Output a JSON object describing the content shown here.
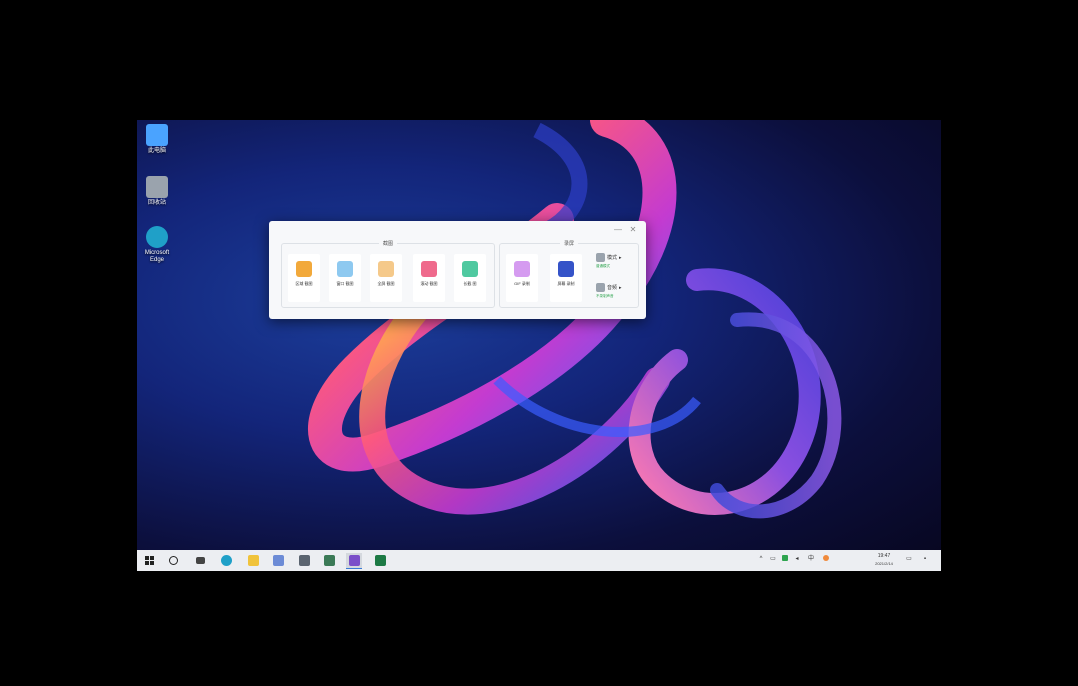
{
  "desktop": {
    "icons": [
      {
        "label": "此电脑",
        "icon": "this-pc-icon",
        "color": "#4aa3ff"
      },
      {
        "label": "回收站",
        "icon": "recycle-bin-icon",
        "color": "#9aa3ad"
      },
      {
        "label": "Microsoft Edge",
        "icon": "edge-icon",
        "color": "#1fa0c8"
      }
    ]
  },
  "dialog": {
    "groups": [
      {
        "title": "截图",
        "tools": [
          {
            "label": "区域 截图",
            "icon": "region-capture-icon",
            "color": "#f2a93b"
          },
          {
            "label": "窗口 截图",
            "icon": "window-capture-icon",
            "color": "#8ec9f0"
          },
          {
            "label": "全屏 截图",
            "icon": "fullscreen-capture-icon",
            "color": "#f5c98a"
          },
          {
            "label": "滚动 截图",
            "icon": "scroll-capture-icon",
            "color": "#ef6a8c"
          },
          {
            "label": "长截 图",
            "icon": "long-capture-icon",
            "color": "#4fc9a0"
          }
        ]
      },
      {
        "title": "录屏",
        "tools": [
          {
            "label": "GIF 录制",
            "icon": "gif-record-icon",
            "color": "#d59bf0"
          },
          {
            "label": "屏幕 录制",
            "icon": "screen-record-icon",
            "color": "#3553c8"
          }
        ],
        "options": [
          {
            "label": "模式",
            "sub": "普通模式",
            "icon": "mode-icon"
          },
          {
            "label": "音频",
            "sub": "不录制声音",
            "icon": "audio-icon"
          }
        ]
      }
    ],
    "minimize_symbol": "—",
    "close_symbol": "✕"
  },
  "taskbar": {
    "start_icon": "windows-start-icon",
    "apps": [
      {
        "icon": "search-circle-icon",
        "color": "#222222"
      },
      {
        "icon": "task-view-icon",
        "color": "#444444"
      },
      {
        "icon": "edge-icon",
        "color": "#1fa0c8"
      },
      {
        "icon": "file-explorer-icon",
        "color": "#f0c33c"
      },
      {
        "icon": "app-icon",
        "color": "#6c8bd6"
      },
      {
        "icon": "app-icon",
        "color": "#5b6470"
      },
      {
        "icon": "app-icon",
        "color": "#3b7a57"
      },
      {
        "icon": "visual-studio-icon",
        "color": "#7b4fc9",
        "active": true
      },
      {
        "icon": "excel-icon",
        "color": "#1d7a45"
      }
    ],
    "tray_icons": [
      "chevron-up-icon",
      "network-icon",
      "app-tray-icon",
      "volume-icon",
      "ime-icon",
      "app-tray-icon"
    ],
    "time": "19:47",
    "date": "2021/2/14"
  }
}
